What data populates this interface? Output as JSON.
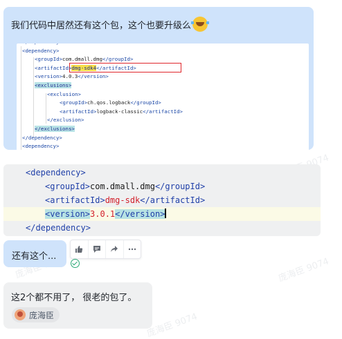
{
  "watermark": "庞海臣 9074",
  "message1": {
    "text": "我们代码中居然还有这个包，这个也要升级么",
    "emoji": "laughing-with-tears",
    "screenshot": {
      "lines": [
        {
          "indent": 0,
          "parts": [
            {
              "t": "</dependency>",
              "c": "t"
            }
          ]
        },
        {
          "indent": 0,
          "parts": [
            {
              "t": "<dependency>",
              "c": "t"
            }
          ]
        },
        {
          "indent": 1,
          "parts": [
            {
              "t": "<groupId>",
              "c": "t"
            },
            {
              "t": "com.dmall.dmg",
              "c": "v"
            },
            {
              "t": "</groupId>",
              "c": "t"
            }
          ]
        },
        {
          "indent": 1,
          "parts": [
            {
              "t": "<artifactId>",
              "c": "t"
            },
            {
              "t": "dmg-sdk4",
              "c": "hly"
            },
            {
              "t": "</artifactId>",
              "c": "t"
            }
          ]
        },
        {
          "indent": 1,
          "parts": [
            {
              "t": "<version>",
              "c": "t"
            },
            {
              "t": "4.0.3",
              "c": "v"
            },
            {
              "t": "</version>",
              "c": "t"
            }
          ]
        },
        {
          "indent": 1,
          "parts": [
            {
              "t": "<exclusions>",
              "c": "hl"
            }
          ]
        },
        {
          "indent": 2,
          "parts": [
            {
              "t": "<exclusion>",
              "c": "t"
            }
          ]
        },
        {
          "indent": 3,
          "parts": [
            {
              "t": "<groupId>",
              "c": "t"
            },
            {
              "t": "ch.qos.logback",
              "c": "v"
            },
            {
              "t": "</groupId>",
              "c": "t"
            }
          ]
        },
        {
          "indent": 3,
          "parts": [
            {
              "t": "<artifactId>",
              "c": "t"
            },
            {
              "t": "logback-classic",
              "c": "v"
            },
            {
              "t": "</artifactId>",
              "c": "t"
            }
          ]
        },
        {
          "indent": 2,
          "parts": [
            {
              "t": "</exclusion>",
              "c": "t"
            }
          ]
        },
        {
          "indent": 1,
          "parts": [
            {
              "t": "</exclusions>",
              "c": "hl"
            }
          ]
        },
        {
          "indent": 0,
          "parts": [
            {
              "t": "</dependency>",
              "c": "t"
            }
          ]
        },
        {
          "indent": 0,
          "parts": [
            {
              "t": "<dependency>",
              "c": "t"
            }
          ]
        }
      ]
    }
  },
  "code_block": {
    "lines": [
      {
        "open": "<dependency>"
      },
      {
        "open": "<groupId>",
        "value": "com.dmall.dmg",
        "close": "</groupId>"
      },
      {
        "open": "<artifactId>",
        "value": "dmg-sdk",
        "close": "</artifactId>"
      },
      {
        "open": "<version>",
        "value": "3.0.1",
        "close": "</version>"
      },
      {
        "open": "</dependency>"
      }
    ]
  },
  "message2": {
    "text": "还有这个..."
  },
  "toolbar": {
    "buttons": [
      {
        "icon": "thumbs-up-icon"
      },
      {
        "icon": "comment-icon"
      },
      {
        "icon": "share-icon"
      },
      {
        "icon": "more-icon"
      }
    ]
  },
  "message3": {
    "text": "这2个都不用了， 很老的包了。",
    "reference_name": "庞海臣"
  }
}
